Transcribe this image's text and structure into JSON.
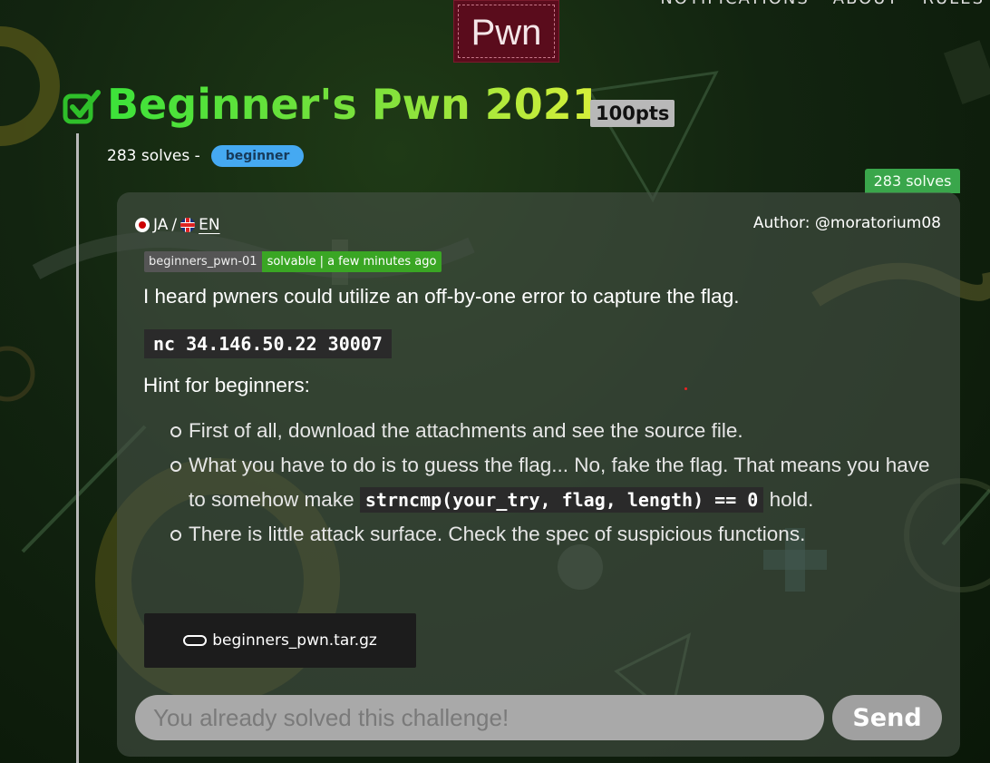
{
  "nav": {
    "items": [
      "NOTIFICATIONS",
      "ABOUT",
      "RULES"
    ]
  },
  "category": "Pwn",
  "challenge": {
    "title": "Beginner's Pwn 2021",
    "points": "100pts",
    "solves_text": "283 solves -",
    "tag": "beginner",
    "solves_badge": "283 solves",
    "solved": true
  },
  "card": {
    "lang_ja": "JA",
    "lang_sep": "/",
    "lang_en": "EN",
    "author": "Author: @moratorium08",
    "status_id": "beginners_pwn-01",
    "status_text": "solvable | a few minutes ago",
    "description": "I heard pwners could utilize an off-by-one error to capture the flag.",
    "command": "nc 34.146.50.22 30007",
    "hint_title": "Hint for beginners:",
    "hints": [
      "First of all, download the attachments and see the source file.",
      "What you have to do is to guess the flag... No, fake the flag. That means you have to somehow make",
      "hold.",
      "There is little attack surface. Check the spec of suspicious functions."
    ],
    "hint_code": "strncmp(your_try, flag, length) == 0",
    "attachment": "beginners_pwn.tar.gz",
    "answer_placeholder": "You already solved this challenge!",
    "send_label": "Send"
  },
  "colors": {
    "category_bg": "#5a0c1c",
    "solved_green": "#3ce23a",
    "tag_blue": "#45a9f2",
    "status_green": "#3aa624"
  }
}
